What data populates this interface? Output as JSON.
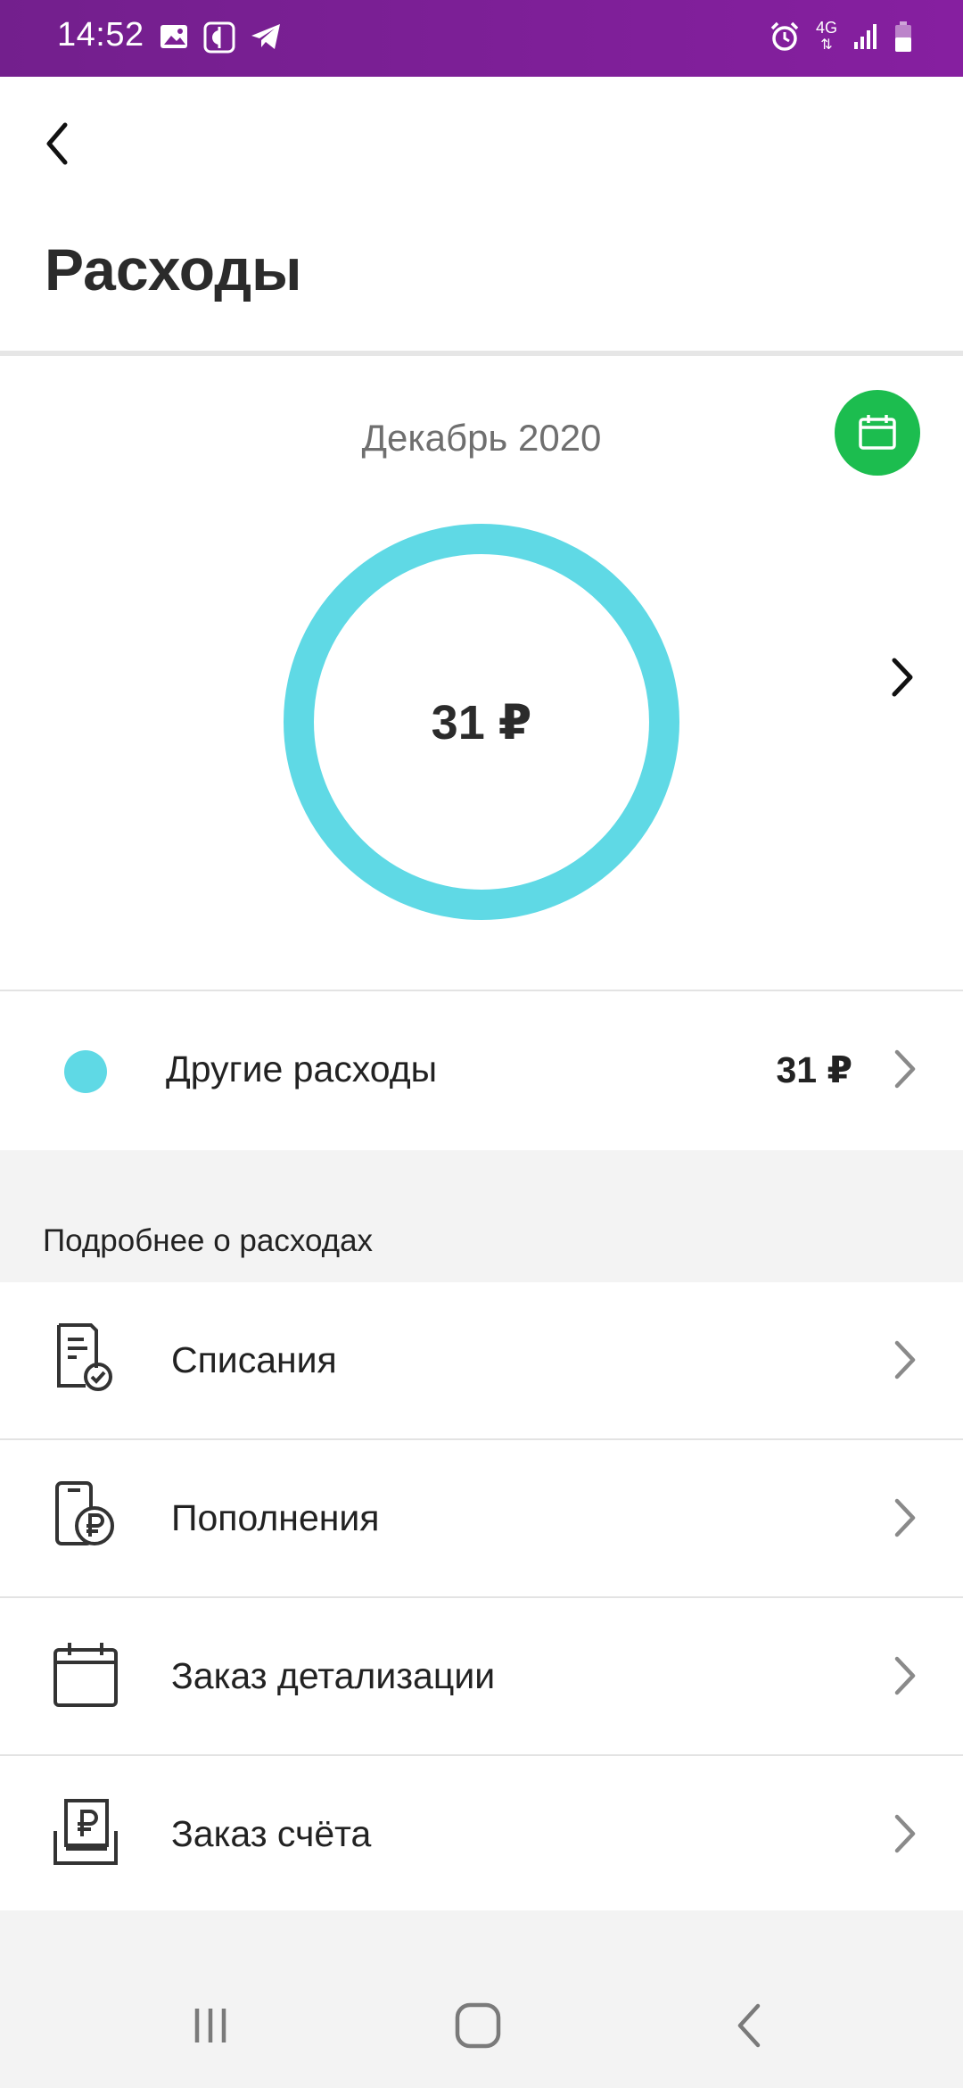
{
  "status_bar": {
    "time": "14:52",
    "left_icons": [
      "image-icon",
      "calendar-app-icon",
      "telegram-icon"
    ],
    "right_icons": [
      "alarm-icon",
      "network-4g-icon",
      "signal-icon",
      "battery-icon"
    ],
    "network_label": "4G",
    "background_color": "#7c1f95"
  },
  "header": {
    "back_icon": "chevron-left-icon",
    "title": "Расходы"
  },
  "chart": {
    "month_label": "Декабрь 2020",
    "calendar_icon": "calendar-icon",
    "total_label": "31 ₽",
    "next_icon": "chevron-right-icon"
  },
  "chart_data": {
    "type": "pie",
    "categories": [
      "Другие расходы"
    ],
    "values": [
      31
    ],
    "colors": [
      "#5fd9e5"
    ],
    "title": "Декабрь 2020",
    "center_label": "31 ₽"
  },
  "categories": [
    {
      "label": "Другие расходы",
      "amount": "31 ₽",
      "color": "#5fd9e5"
    }
  ],
  "details_section": {
    "title": "Подробнее о расходах",
    "items": [
      {
        "label": "Списания",
        "icon": "document-check-icon"
      },
      {
        "label": "Пополнения",
        "icon": "phone-ruble-icon"
      },
      {
        "label": "Заказ детализации",
        "icon": "calendar-icon"
      },
      {
        "label": "Заказ счёта",
        "icon": "invoice-ruble-icon"
      }
    ]
  },
  "nav_bar": {
    "buttons": [
      "recent-apps-icon",
      "home-icon",
      "back-icon"
    ]
  },
  "colors": {
    "accent_green": "#1cbd4f",
    "donut_color": "#5fd9e5",
    "status_purple": "#7c1f95"
  }
}
